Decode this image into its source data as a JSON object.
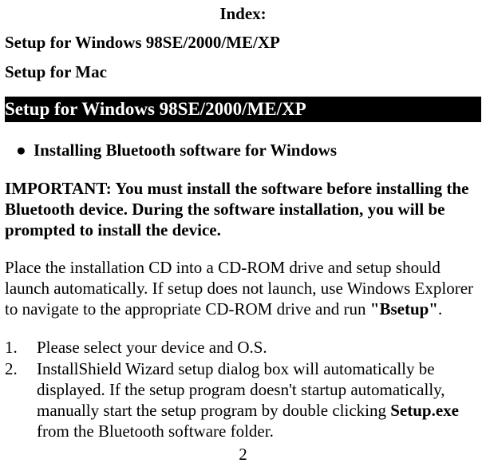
{
  "index_title": "Index:",
  "toc": {
    "line1": "Setup for Windows 98SE/2000/ME/XP",
    "line2": "Setup for Mac"
  },
  "section_heading": "Setup for Windows 98SE/2000/ME/XP",
  "bullet": {
    "dot": "●",
    "text": "Installing Bluetooth software for Windows"
  },
  "important": "IMPORTANT: You must install the software before installing the Bluetooth device. During the software installation, you will be prompted to install the device.",
  "para_prefix": "Place the installation CD into a CD-ROM drive and setup should launch automatically. If setup does not launch, use Windows Explorer to navigate to the appropriate CD-ROM drive and run ",
  "para_bold": "\"Bsetup\"",
  "para_suffix": ".",
  "steps": [
    {
      "num": "1.",
      "text": "Please select your device and O.S."
    },
    {
      "num": "2.",
      "text_before": "InstallShield Wizard setup dialog box will automatically be displayed. If the setup program doesn't startup automatically, manually start the setup program by double clicking ",
      "bold": "Setup.exe",
      "text_after": " from the Bluetooth software folder."
    }
  ],
  "page_number": "2"
}
